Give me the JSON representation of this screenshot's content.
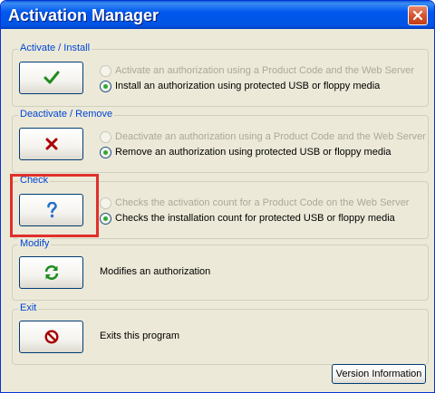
{
  "window": {
    "title": "Activation Manager",
    "close_icon": "close-icon"
  },
  "groups": {
    "activate": {
      "label": "Activate / Install",
      "button_icon": "checkmark-icon",
      "options": [
        {
          "label": "Activate an authorization using a Product Code and the Web Server",
          "selected": false,
          "enabled": false
        },
        {
          "label": "Install an authorization using protected USB or floppy media",
          "selected": true,
          "enabled": true
        }
      ]
    },
    "deactivate": {
      "label": "Deactivate / Remove",
      "button_icon": "x-mark-icon",
      "options": [
        {
          "label": "Deactivate an authorization using a Product Code and the Web Server",
          "selected": false,
          "enabled": false
        },
        {
          "label": "Remove an authorization using protected USB or floppy media",
          "selected": true,
          "enabled": true
        }
      ]
    },
    "check": {
      "label": "Check",
      "button_icon": "question-mark-icon",
      "options": [
        {
          "label": "Checks the activation count for a Product Code on the Web Server",
          "selected": false,
          "enabled": false
        },
        {
          "label": "Checks the installation count for protected USB or floppy media",
          "selected": true,
          "enabled": true
        }
      ]
    },
    "modify": {
      "label": "Modify",
      "button_icon": "refresh-icon",
      "description": "Modifies an authorization"
    },
    "exit": {
      "label": "Exit",
      "button_icon": "no-entry-icon",
      "description": "Exits this program"
    }
  },
  "footer": {
    "version_button": "Version Information"
  },
  "colors": {
    "titlebar": "#0054e3",
    "group_label": "#0046d5",
    "highlight": "#e0302c",
    "check_green": "#1e8c1e",
    "x_red": "#a80000",
    "question_blue": "#2a6fc9"
  }
}
